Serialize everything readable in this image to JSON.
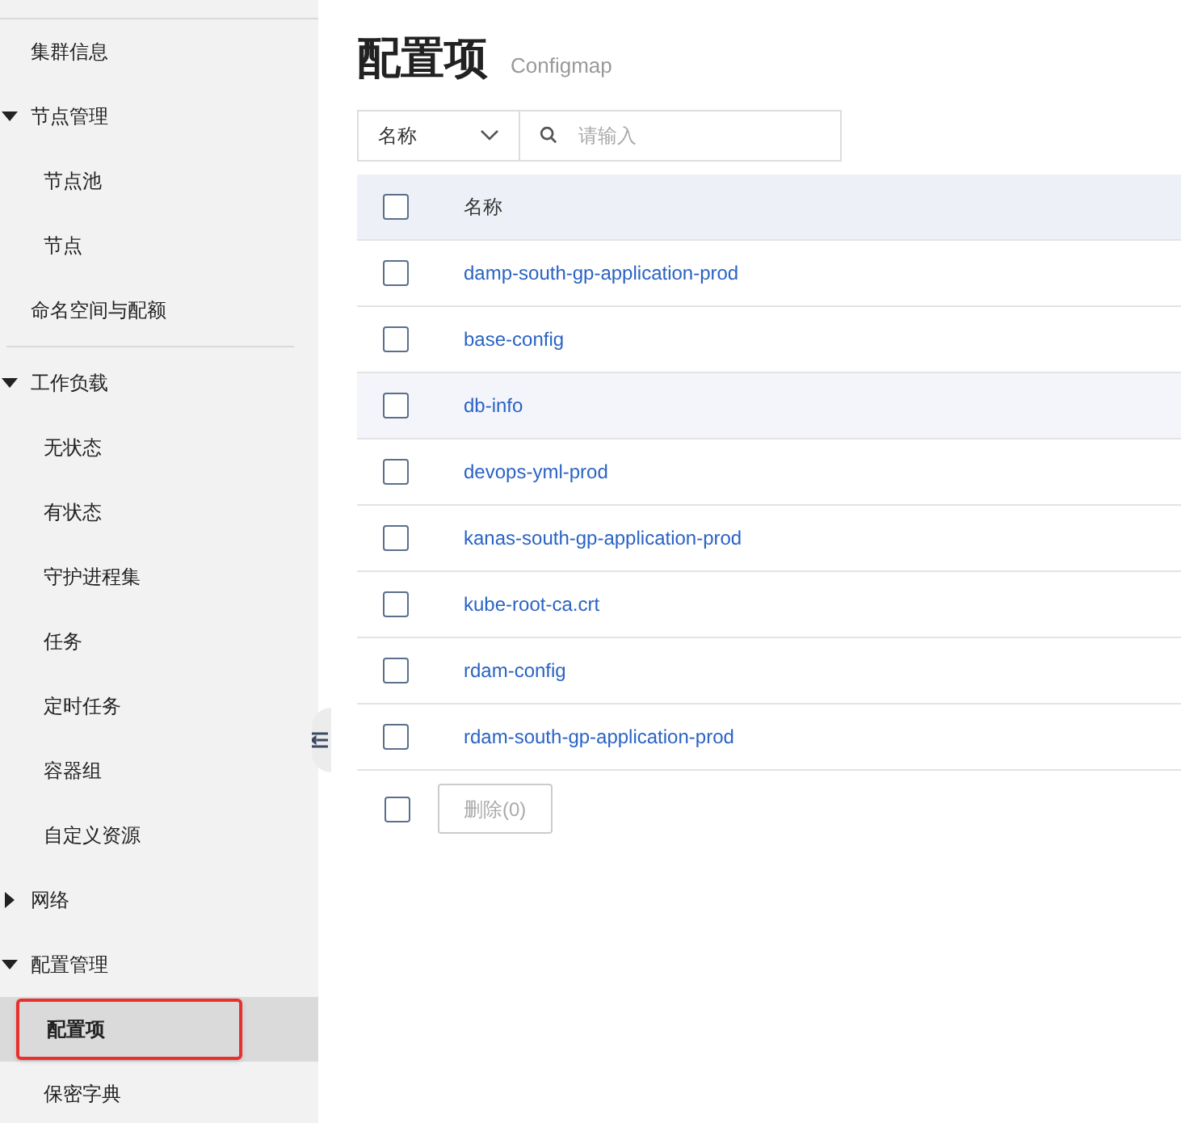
{
  "sidebar": {
    "items": [
      {
        "label": "集群信息",
        "selected": false
      },
      {
        "label": "节点管理",
        "expanded": true,
        "children": [
          {
            "label": "节点池",
            "selected": false
          },
          {
            "label": "节点",
            "selected": false
          }
        ]
      },
      {
        "label": "命名空间与配额",
        "selected": false,
        "divider_after": true
      },
      {
        "label": "工作负载",
        "expanded": true,
        "children": [
          {
            "label": "无状态",
            "selected": false
          },
          {
            "label": "有状态",
            "selected": false
          },
          {
            "label": "守护进程集",
            "selected": false
          },
          {
            "label": "任务",
            "selected": false
          },
          {
            "label": "定时任务",
            "selected": false
          },
          {
            "label": "容器组",
            "selected": false
          },
          {
            "label": "自定义资源",
            "selected": false
          }
        ]
      },
      {
        "label": "网络",
        "expanded": false
      },
      {
        "label": "配置管理",
        "expanded": true,
        "children": [
          {
            "label": "配置项",
            "selected": true
          },
          {
            "label": "保密字典",
            "selected": false
          }
        ]
      }
    ]
  },
  "page": {
    "title": "配置项",
    "subtitle": "Configmap"
  },
  "filter": {
    "field": "名称",
    "placeholder": "请输入"
  },
  "table": {
    "columns": [
      "名称"
    ],
    "header_checked": false,
    "rows": [
      {
        "name": "damp-south-gp-application-prod",
        "checked": false,
        "hovered": false
      },
      {
        "name": "base-config",
        "checked": false,
        "hovered": false
      },
      {
        "name": "db-info",
        "checked": false,
        "hovered": true
      },
      {
        "name": "devops-yml-prod",
        "checked": false,
        "hovered": false
      },
      {
        "name": "kanas-south-gp-application-prod",
        "checked": false,
        "hovered": false
      },
      {
        "name": "kube-root-ca.crt",
        "checked": false,
        "hovered": false
      },
      {
        "name": "rdam-config",
        "checked": false,
        "hovered": false
      },
      {
        "name": "rdam-south-gp-application-prod",
        "checked": false,
        "hovered": false
      }
    ]
  },
  "footer": {
    "checked": false,
    "delete_button": {
      "label": "删除(0)",
      "disabled": true
    }
  }
}
